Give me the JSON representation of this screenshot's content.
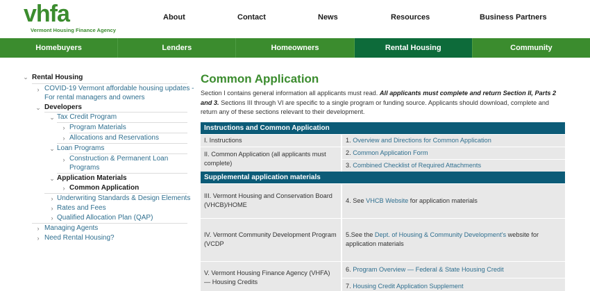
{
  "logo": {
    "wordmark": "vhfa",
    "tagline": "Vermont Housing Finance Agency"
  },
  "top_nav": [
    "About",
    "Contact",
    "News",
    "Resources",
    "Business Partners"
  ],
  "main_nav": [
    "Homebuyers",
    "Lenders",
    "Homeowners",
    "Rental Housing",
    "Community"
  ],
  "main_nav_active": "Rental Housing",
  "colors": {
    "brand_green": "#3b8c2e",
    "active_nav": "#0d6b3a",
    "table_header": "#0c5b77",
    "link": "#2f6f8f"
  },
  "sidebar": {
    "root": "Rental Housing",
    "covid": {
      "line1": "COVID-19 Vermont affordable housing updates -",
      "line2": "For rental managers and owners"
    },
    "developers": "Developers",
    "tax_credit": "Tax Credit Program",
    "program_materials": "Program Materials",
    "allocations": "Allocations and Reservations",
    "loan_programs": "Loan Programs",
    "construction": {
      "line1": "Construction & Permanent Loan",
      "line2": "Programs"
    },
    "application_materials": "Application Materials",
    "common_application": "Common Application",
    "underwriting": "Underwriting Standards & Design Elements",
    "rates_fees": "Rates and Fees",
    "qap": "Qualified Allocation Plan (QAP)",
    "managing_agents": "Managing Agents",
    "need_rental": "Need Rental Housing?"
  },
  "main": {
    "title": "Common Application",
    "intro_part1": "Section I contains general information all applicants must read.  ",
    "intro_emph": "All applicants must complete and return Section II, Parts 2 and 3.",
    "intro_part2": " Sections III through VI are specific to a single program or funding source.  Applicants should download, complete and return any of these sections relevant to their development."
  },
  "table": {
    "header1": "Instructions and Common Application",
    "header2": "Supplemental application materials",
    "row_instructions": {
      "section": "I. Instructions",
      "num": "1. ",
      "link": "Overview and Directions for Common Application"
    },
    "row_common": {
      "section": "II. Common Application (all applicants must complete)",
      "doc2_num": "2. ",
      "doc2_link": "Common Application Form",
      "doc3_num": "3. ",
      "doc3_link": "Combined Checklist of Required Attachments"
    },
    "row_vhcb": {
      "section": "III. Vermont Housing and Conservation Board (VHCB)/HOME",
      "pre": "4. See ",
      "link": "VHCB Website",
      "post": " for application materials"
    },
    "row_vcdp": {
      "section": "IV. Vermont Community Development Program (VCDP",
      "pre": "5.See the ",
      "link": "Dept. of Housing & Community Development's",
      "post": " website for application materials"
    },
    "row_vhfa": {
      "section": "V. Vermont Housing Finance Agency (VHFA) — Housing Credits",
      "doc6_num": "6. ",
      "doc6_link": "Program Overview — Federal & State Housing Credit",
      "doc7_num": "7. ",
      "doc7_link": "Housing Credit Application Supplement"
    }
  }
}
